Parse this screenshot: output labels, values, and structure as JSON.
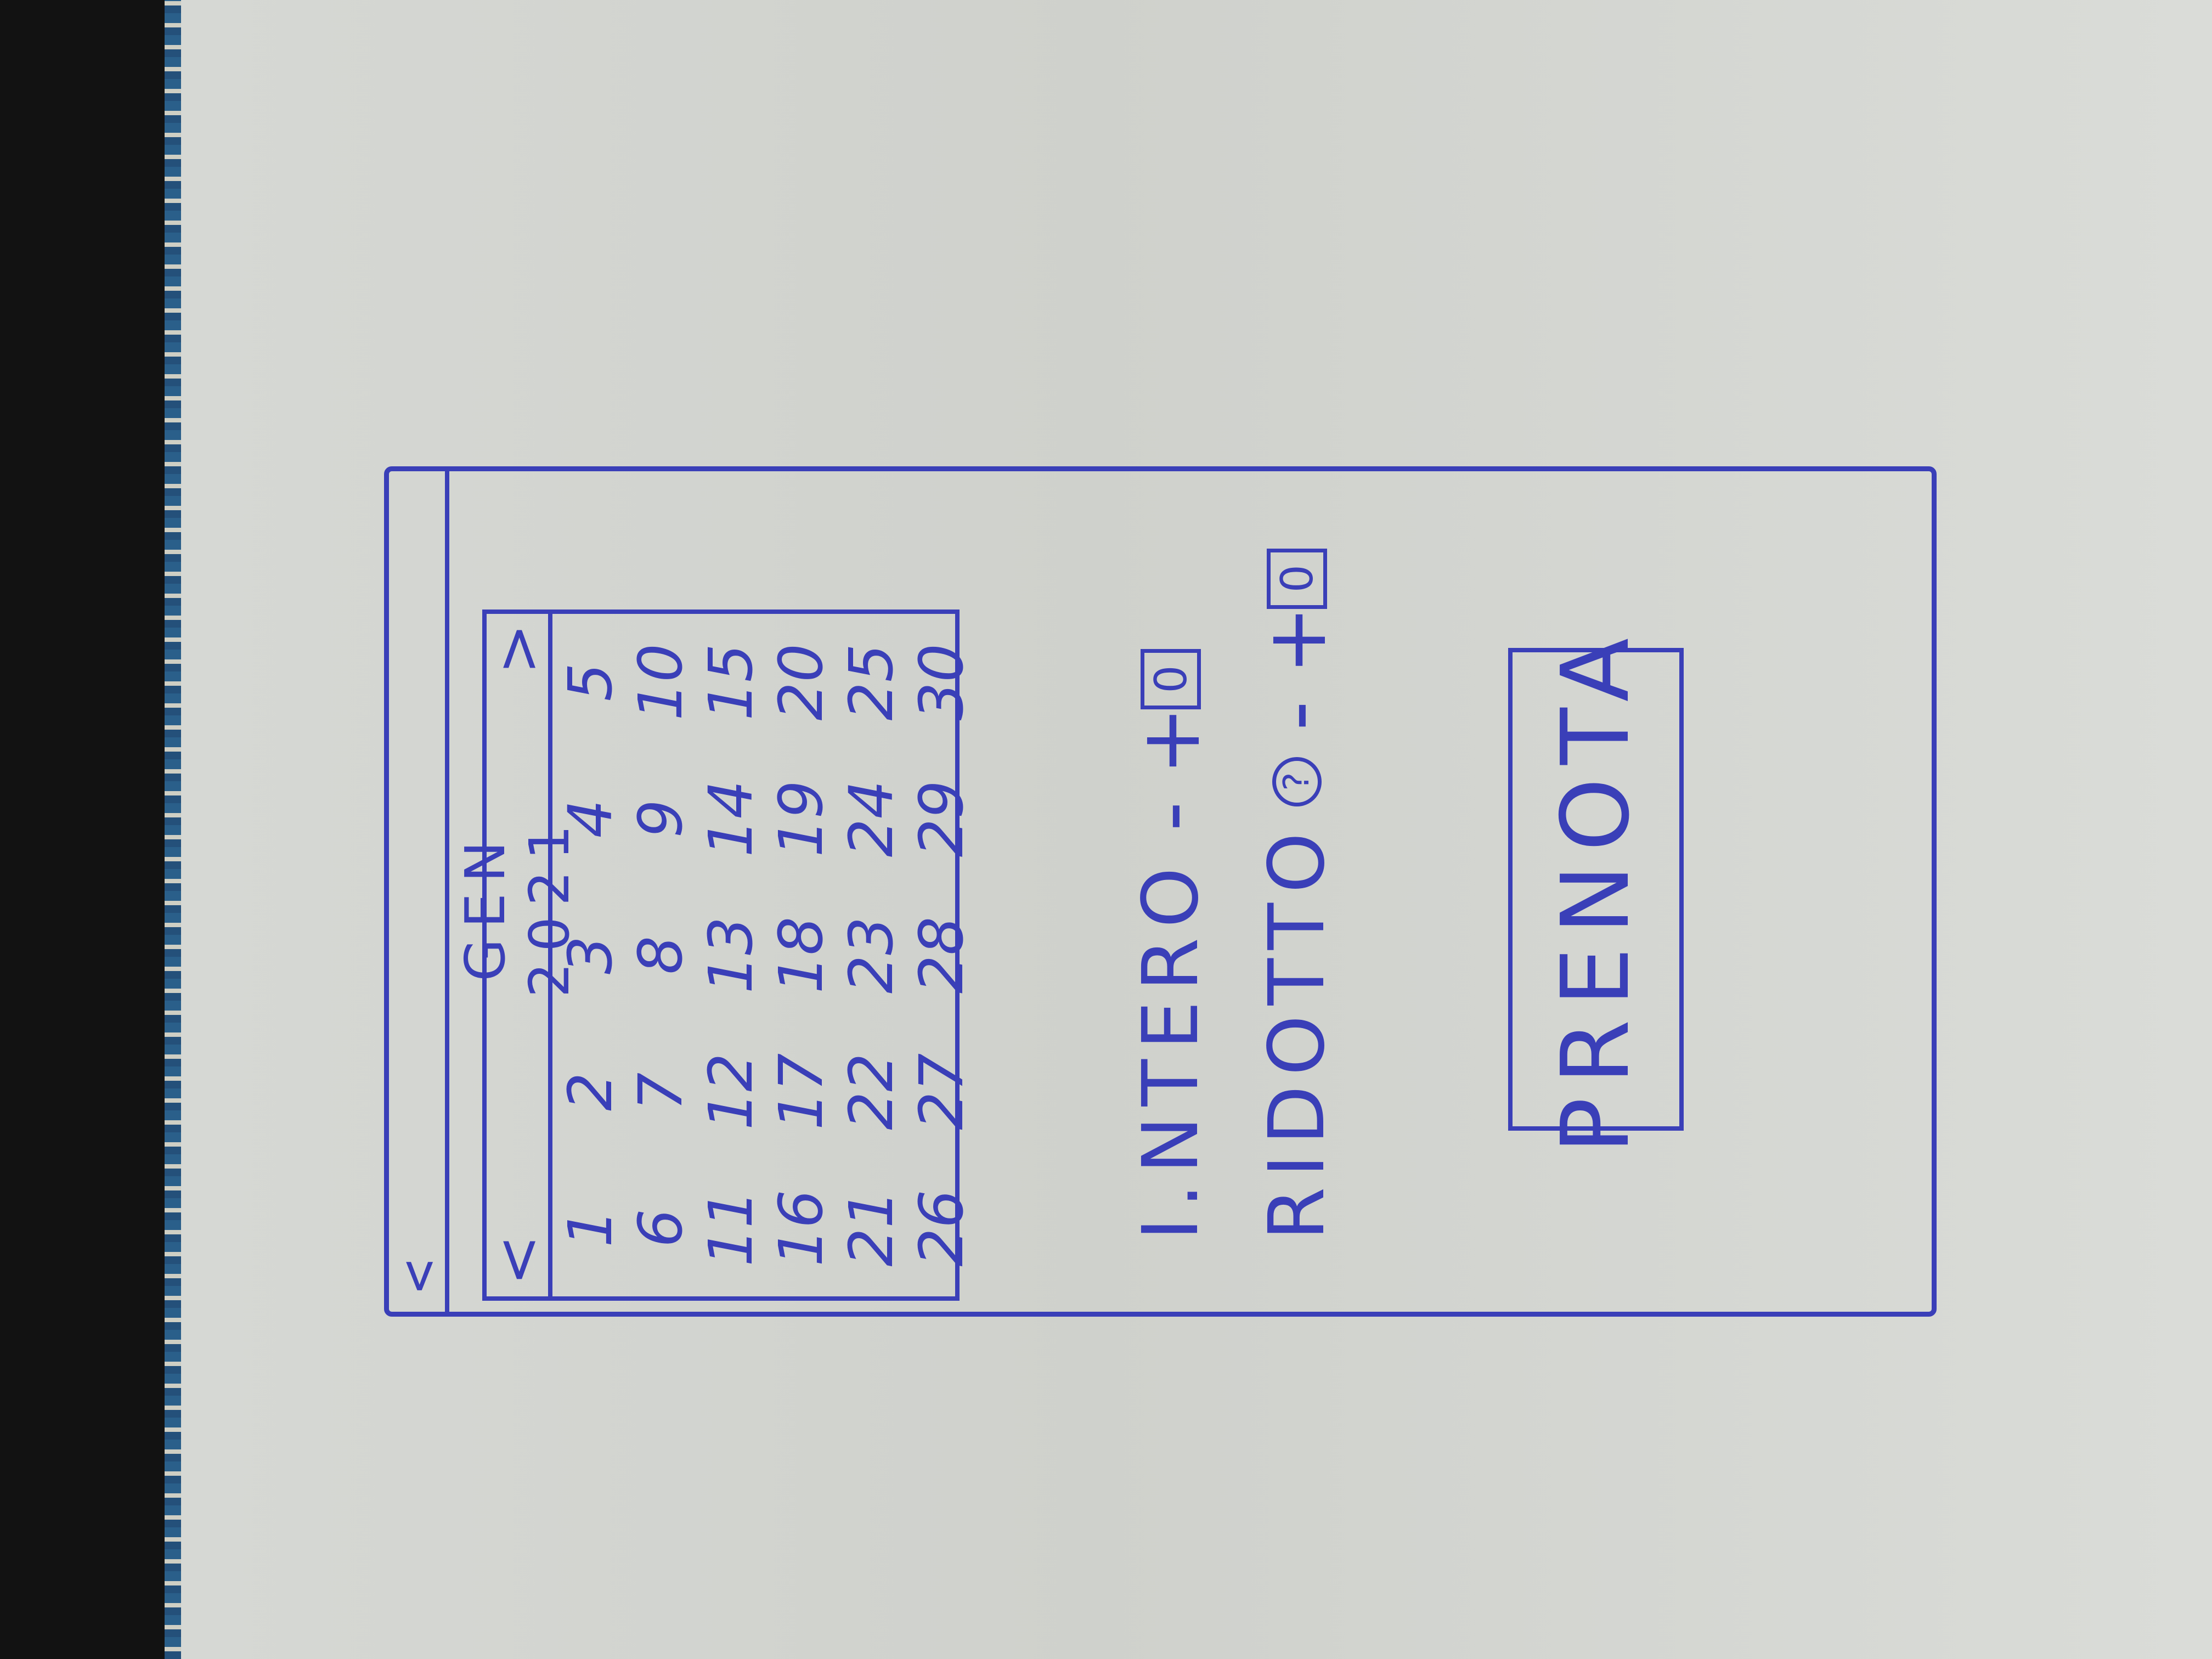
{
  "topbar": {
    "back_icon": "<"
  },
  "calendar": {
    "prev_icon": "<",
    "next_icon": ">",
    "month": "GEN",
    "year": "2021",
    "days": [
      "1",
      "2",
      "3",
      "4",
      "5",
      "6",
      "7",
      "8",
      "9",
      "10",
      "11",
      "12",
      "13",
      "14",
      "15",
      "16",
      "17",
      "18",
      "19",
      "20",
      "21",
      "22",
      "23",
      "24",
      "25",
      "26",
      "27",
      "28",
      "29",
      "30"
    ]
  },
  "tickets": [
    {
      "label": "I.NTERO",
      "minus": "-",
      "plus": "+",
      "qty": "0"
    },
    {
      "label": "RIDOTTO",
      "info_icon": "?",
      "minus": "-",
      "plus": "+",
      "qty": "0"
    }
  ],
  "book_button": {
    "label": "PRENOTA"
  },
  "colors": {
    "ink": "#3a3fb8",
    "paper": "#d6d8d4"
  }
}
